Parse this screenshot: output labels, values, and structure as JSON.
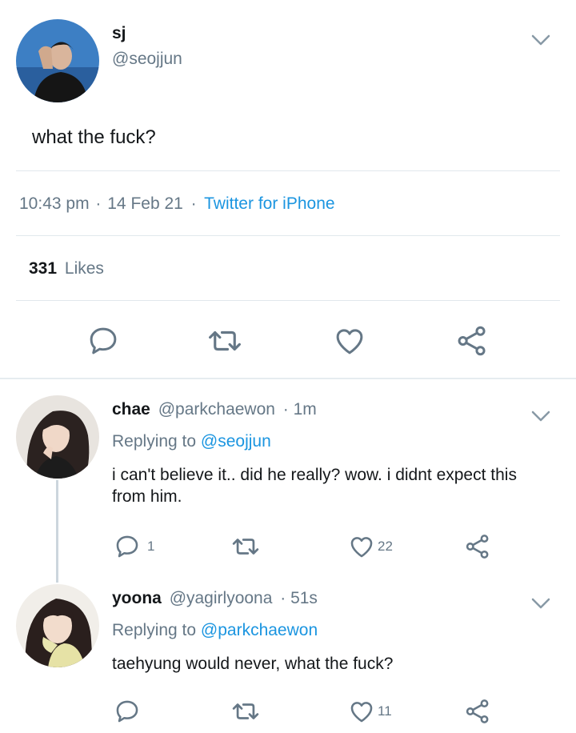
{
  "main_tweet": {
    "display_name": "sj",
    "handle": "@seojjun",
    "text": "what the fuck?",
    "time": "10:43 pm",
    "date": "14 Feb 21",
    "sep": "·",
    "source": "Twitter for iPhone",
    "likes_count": "331",
    "likes_label": "Likes"
  },
  "replies": [
    {
      "name": "chae",
      "handle": "@parkchaewon",
      "meta": "· 1m",
      "replying_prefix": "Replying to",
      "replying_to": "@seojjun",
      "text": "i can't believe it.. did he really? wow. i didnt expect this from him.",
      "reply_count": "1",
      "like_count": "22"
    },
    {
      "name": "yoona",
      "handle": "@yagirlyoona",
      "meta": "· 51s",
      "replying_prefix": "Replying to",
      "replying_to": "@parkchaewon",
      "text": "taehyung would never, what the fuck?",
      "reply_count": "",
      "like_count": "11"
    }
  ],
  "icons": {
    "reply": "speech-bubble",
    "retweet": "retweet-arrows",
    "like": "heart",
    "share": "share-nodes",
    "more": "chevron-down"
  },
  "colors": {
    "link": "#1b95e0",
    "muted": "#657786",
    "divider": "#e1e8ed",
    "icon": "#657786"
  }
}
